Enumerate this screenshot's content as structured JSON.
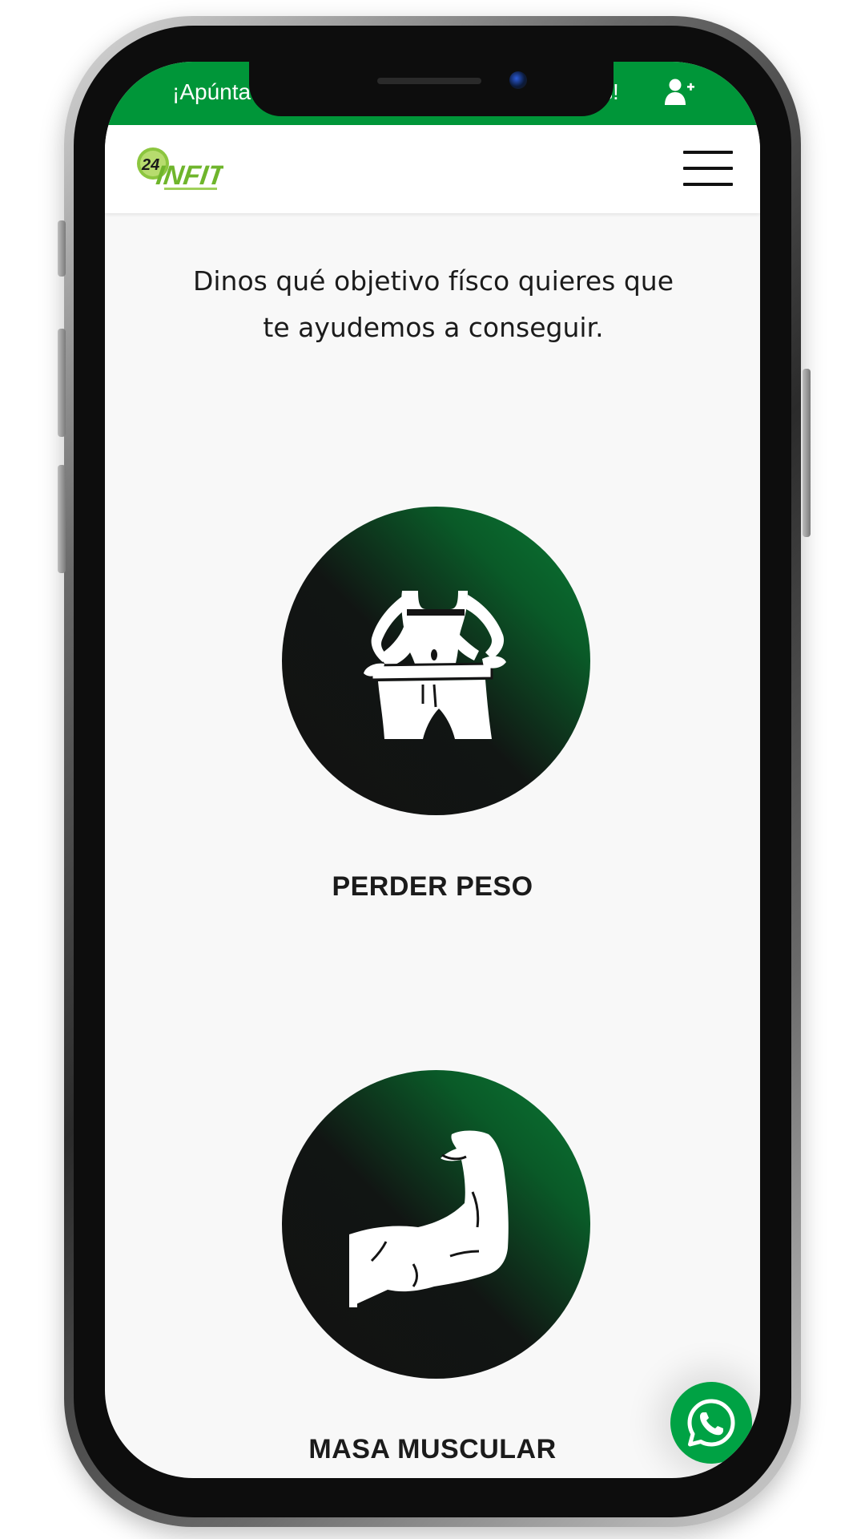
{
  "topbar": {
    "promo_left": "¡Apúnta",
    "promo_right": "s!",
    "color": "#009639"
  },
  "header": {
    "logo_alt": "24 INFIT",
    "menu_icon": "hamburger-icon"
  },
  "intro": {
    "line1": "Dinos qué objetivo físco quieres que",
    "line2": "te ayudemos a conseguir."
  },
  "goals": [
    {
      "label": "PERDER PESO",
      "icon": "waist-icon"
    },
    {
      "label": "MASA MUSCULAR",
      "icon": "flexed-arm-icon"
    }
  ],
  "whatsapp": {
    "icon": "whatsapp-icon",
    "color": "#00a244"
  }
}
